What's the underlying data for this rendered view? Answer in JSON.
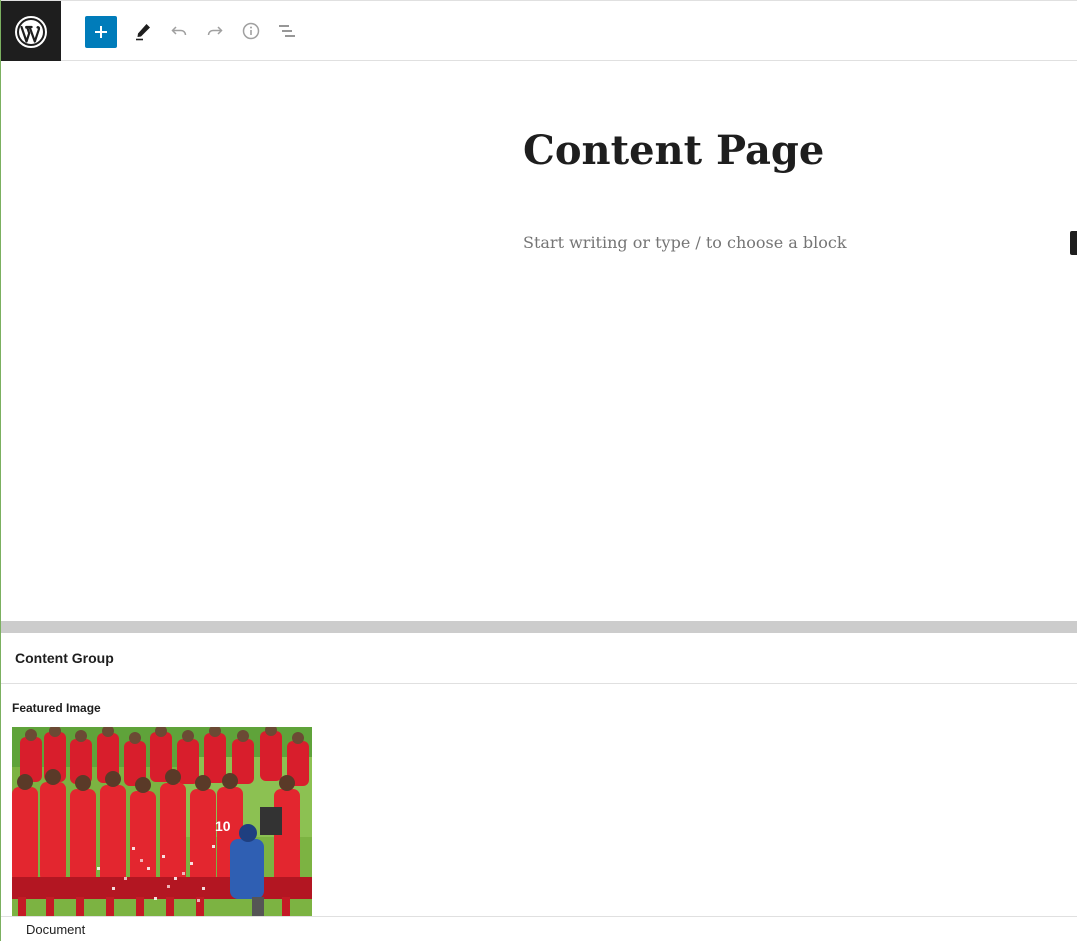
{
  "toolbar": {
    "logo_icon": "wordpress-logo-icon",
    "add_block_icon": "plus-icon",
    "tools_icon": "pencil-icon",
    "undo_icon": "undo-icon",
    "redo_icon": "redo-icon",
    "details_icon": "info-icon",
    "list_view_icon": "list-view-icon",
    "accent_color": "#007cba"
  },
  "editor": {
    "title": "Content Page",
    "placeholder": "Start writing or type / to choose a block"
  },
  "meta_boxes": {
    "group_title": "Content Group",
    "featured_image_label": "Featured Image",
    "featured_image_icon": "team-celebration-photo"
  },
  "footer": {
    "breadcrumb": "Document"
  }
}
